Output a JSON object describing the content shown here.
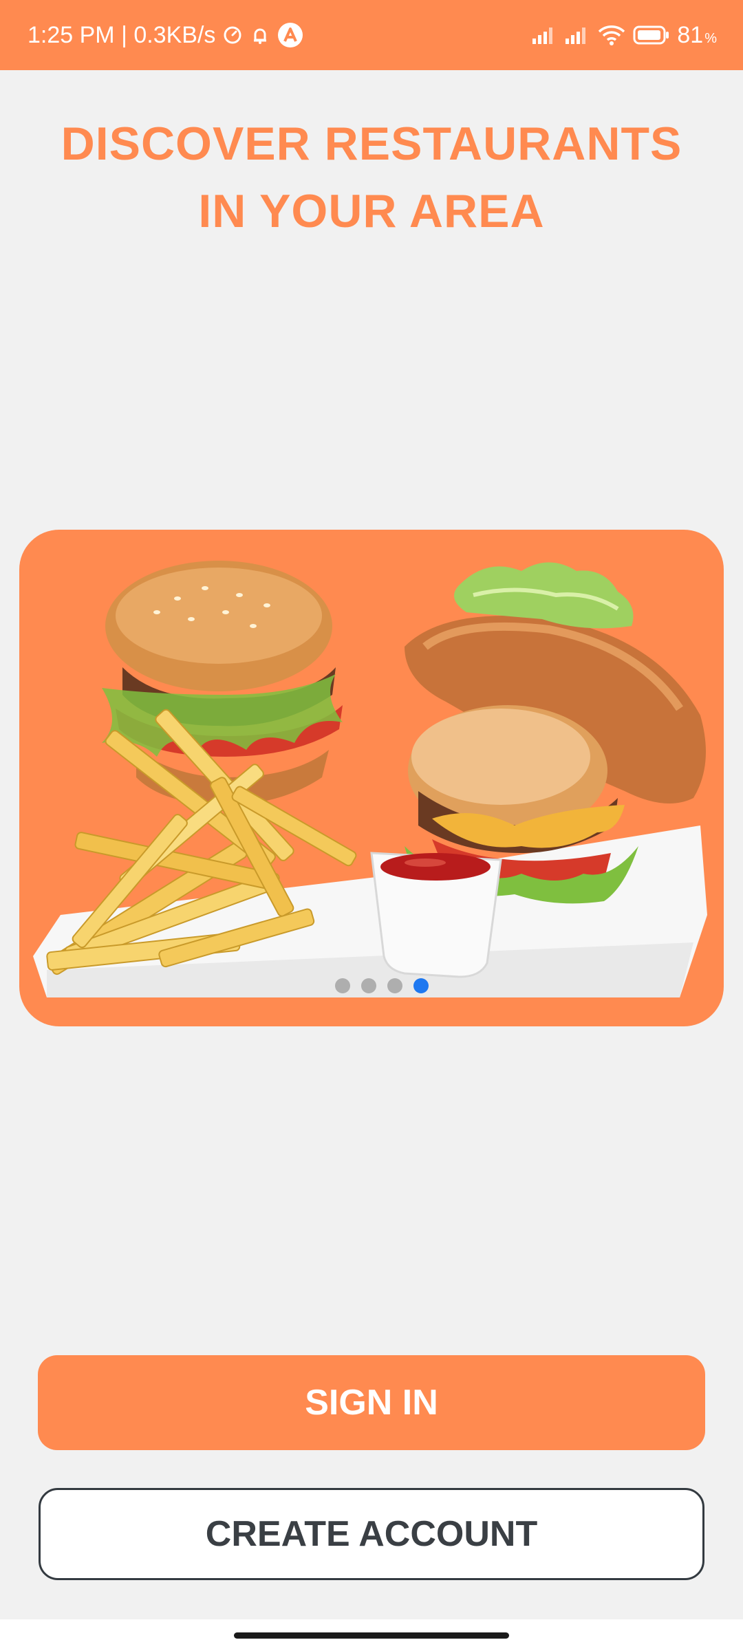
{
  "status_bar": {
    "time_info": "1:25 PM | 0.3KB/s",
    "battery_level": "81",
    "battery_unit": "%",
    "icons": [
      "timer-icon",
      "alarm-icon",
      "app-a-icon",
      "signal-icon",
      "signal-icon",
      "wifi-icon",
      "battery-icon"
    ]
  },
  "heading": {
    "line1": "DISCOVER RESTAURANTS",
    "line2": "IN YOUR AREA"
  },
  "carousel": {
    "image": "burgers-and-fries",
    "page_count": 4,
    "active_index": 3
  },
  "buttons": {
    "sign_in": "SIGN IN",
    "create_account": "CREATE ACCOUNT"
  },
  "colors": {
    "accent": "#ff8a50",
    "background": "#f1f1f1",
    "active_dot": "#1e78f0",
    "dark_text": "#3a3f44"
  }
}
